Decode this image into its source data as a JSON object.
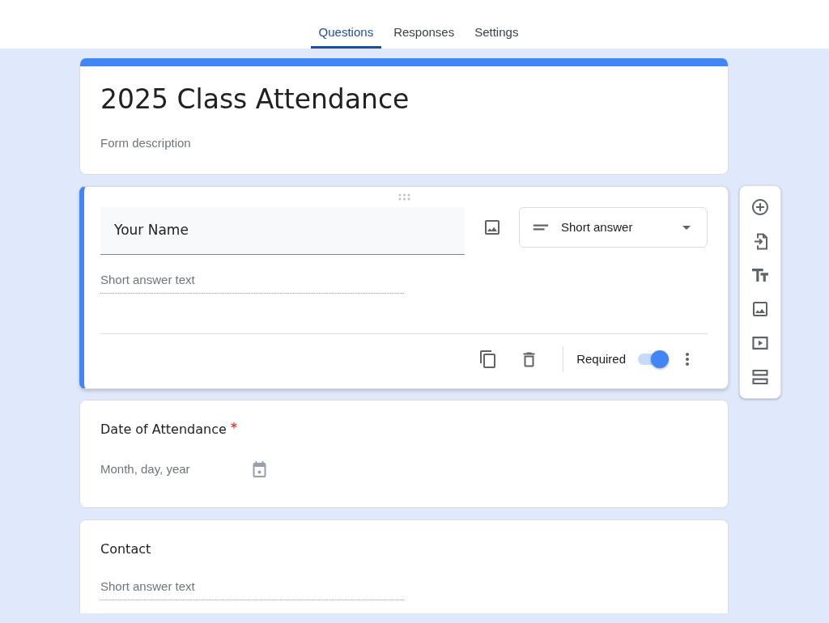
{
  "tabs": [
    {
      "label": "Questions",
      "selected": true
    },
    {
      "label": "Responses",
      "selected": false
    },
    {
      "label": "Settings",
      "selected": false
    }
  ],
  "form_header": {
    "title": "2025 Class Attendance",
    "description": {
      "placeholder": "Form description"
    }
  },
  "questions": [
    {
      "kind": "short_answer",
      "active": true,
      "title": "Your Name",
      "required": true,
      "answer": {
        "placeholder": "Short answer text"
      },
      "type_select": {
        "value": "Short answer"
      },
      "required_label": "Required"
    },
    {
      "kind": "date",
      "active": false,
      "title": "Date of Attendance",
      "required": true,
      "answer": {
        "placeholder": "Month, day, year"
      }
    },
    {
      "kind": "short_answer",
      "active": false,
      "title": "Contact",
      "required": false,
      "answer": {
        "placeholder": "Short answer text"
      }
    }
  ]
}
